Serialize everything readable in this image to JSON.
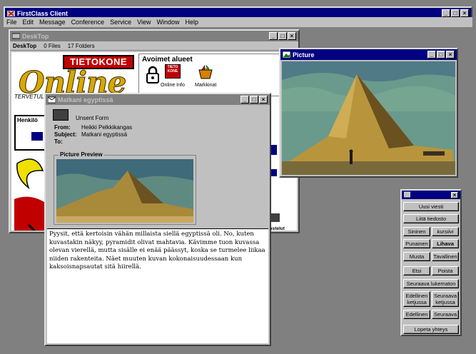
{
  "app": {
    "title": "FirstClass Client",
    "menu": [
      "File",
      "Edit",
      "Message",
      "Conference",
      "Service",
      "View",
      "Window",
      "Help"
    ]
  },
  "desktop": {
    "title": "DeskTop",
    "info": {
      "name": "DeskTop",
      "files": "0 Files",
      "folders": "17 Folders"
    },
    "logo": {
      "brand": "TIETOKONE",
      "online": "Online",
      "tagline": "TERVETULOA!"
    },
    "areas": {
      "header": "Avoimet alueet",
      "items": [
        "Online Info",
        "Markkinat"
      ]
    },
    "left_label": "Henkilö",
    "partial_label": "kustelut"
  },
  "message": {
    "title": "Matkani egyptissä",
    "status": "Unsent Form",
    "from_label": "From:",
    "from": "Heikki Pelkkikangas",
    "subject_label": "Subject:",
    "subject": "Matkani egyptissä",
    "to_label": "To:",
    "to": "",
    "preview_label": "Picture Preview",
    "body": "Pyysit, että kertoisin vähän millaista siellä egyptissä oli.  No, kuten kuvastakin näkyy, pyramidit olivat mahtavia.  Kävimme tuon kuvassa olevan vierellä, mutta sisälle ei enää päässyt, koska se turmelee liikaa niiden rakenteita.  Näet muuten kuvan kokonaisuudessaan kun kaksoisnapsautat sitä hiirellä."
  },
  "picture": {
    "title": "Picture"
  },
  "toolbar": {
    "buttons": {
      "new": "Uusi viesti",
      "attach": "Liitä tiedosto",
      "blue": "Sininen",
      "italic": "kursiivi",
      "red": "Punainen",
      "bold": "Lihava",
      "black": "Musta",
      "plain": "Tavallinen",
      "find": "Etsi",
      "delete": "Poista",
      "next_unread": "Seuraava lukematon",
      "prev_thread_1": "Edellinen",
      "prev_thread_2": "ketjussa",
      "next_thread_1": "Seuraava",
      "next_thread_2": "ketjussa",
      "prev": "Edellinen",
      "next": "Seuraava",
      "quit": "Lopeta yhteys"
    }
  },
  "colors": {
    "titlebar": "#000080",
    "face": "#c0c0c0",
    "logo_red": "#c00000",
    "logo_gold": "#d8a800"
  }
}
